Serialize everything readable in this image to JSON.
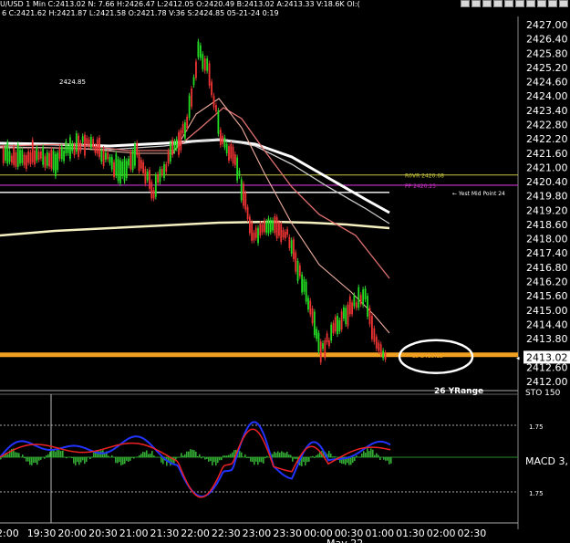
{
  "window": {
    "title_line": "U/USD 1 Min C:2413.02 N: 7.66 H:2426.47 L:2412.05 O:2420.49 B:2413.02 A:2413.33 V:18.6K OI:(",
    "info_line": "6 C:2421.62 H:2421.87 L:2421.58 O:2421.78 V:36 S:2424.85 05-21-24 0:19"
  },
  "chart_data": {
    "type": "line",
    "title": "",
    "price_axis": {
      "min": 2412.0,
      "max": 2427.0,
      "tick_labels": [
        "2427.00",
        "2426.40",
        "2425.80",
        "2425.20",
        "2424.60",
        "2424.00",
        "2423.40",
        "2422.80",
        "2422.20",
        "2421.60",
        "2421.00",
        "2420.40",
        "2419.80",
        "2419.20",
        "2418.60",
        "2418.00",
        "2417.40",
        "2416.80",
        "2416.20",
        "2415.60",
        "2415.00",
        "2414.40",
        "2413.80",
        "2413.02",
        "2412.60",
        "2412.00"
      ]
    },
    "time_axis": {
      "tick_labels": [
        "2:00",
        "19:30",
        "20:00",
        "20:30",
        "21:00",
        "21:30",
        "22:00",
        "22:30",
        "23:00",
        "23:30",
        "00:00",
        "00:30",
        "01:00",
        "01:30",
        "02:00",
        "02:30"
      ],
      "sublabel": "May 22"
    },
    "price_series": {
      "name": "",
      "x": [
        "19:15",
        "19:30",
        "19:45",
        "20:00",
        "20:15",
        "20:30",
        "20:45",
        "21:00",
        "21:15",
        "21:30",
        "21:45",
        "22:00",
        "22:10",
        "22:20",
        "22:30",
        "22:45",
        "23:00",
        "23:15",
        "23:30",
        "23:45",
        "00:00",
        "00:15",
        "00:30",
        "00:40",
        "00:50",
        "01:00"
      ],
      "values": [
        2421.5,
        2421.3,
        2421.6,
        2421.2,
        2421.8,
        2422.1,
        2421.5,
        2420.8,
        2421.6,
        2420.0,
        2421.5,
        2422.8,
        2425.9,
        2425.0,
        2422.3,
        2421.0,
        2418.0,
        2418.6,
        2418.2,
        2416.0,
        2413.2,
        2414.4,
        2415.3,
        2415.7,
        2413.5,
        2412.8
      ]
    },
    "current_price": "2413.02",
    "horizontal_lines": [
      {
        "label": "R0VR 2420.68",
        "value": 2420.68,
        "color": "#c8c840"
      },
      {
        "label": "PP 2420.25",
        "value": 2420.25,
        "color": "#cc33cc"
      },
      {
        "label": "Yest Mid Point 24",
        "value": 2419.95,
        "color": "#ffffff"
      },
      {
        "label": "L3 2413.12",
        "value": 2413.12,
        "color": "#f0a020"
      }
    ],
    "annotations": [
      "2424.85",
      "26 YRange"
    ],
    "macd": {
      "label": "MACD 3,",
      "upper_label": "1.75",
      "lower_label": "1.75",
      "stoch_label": "STO 150"
    }
  }
}
